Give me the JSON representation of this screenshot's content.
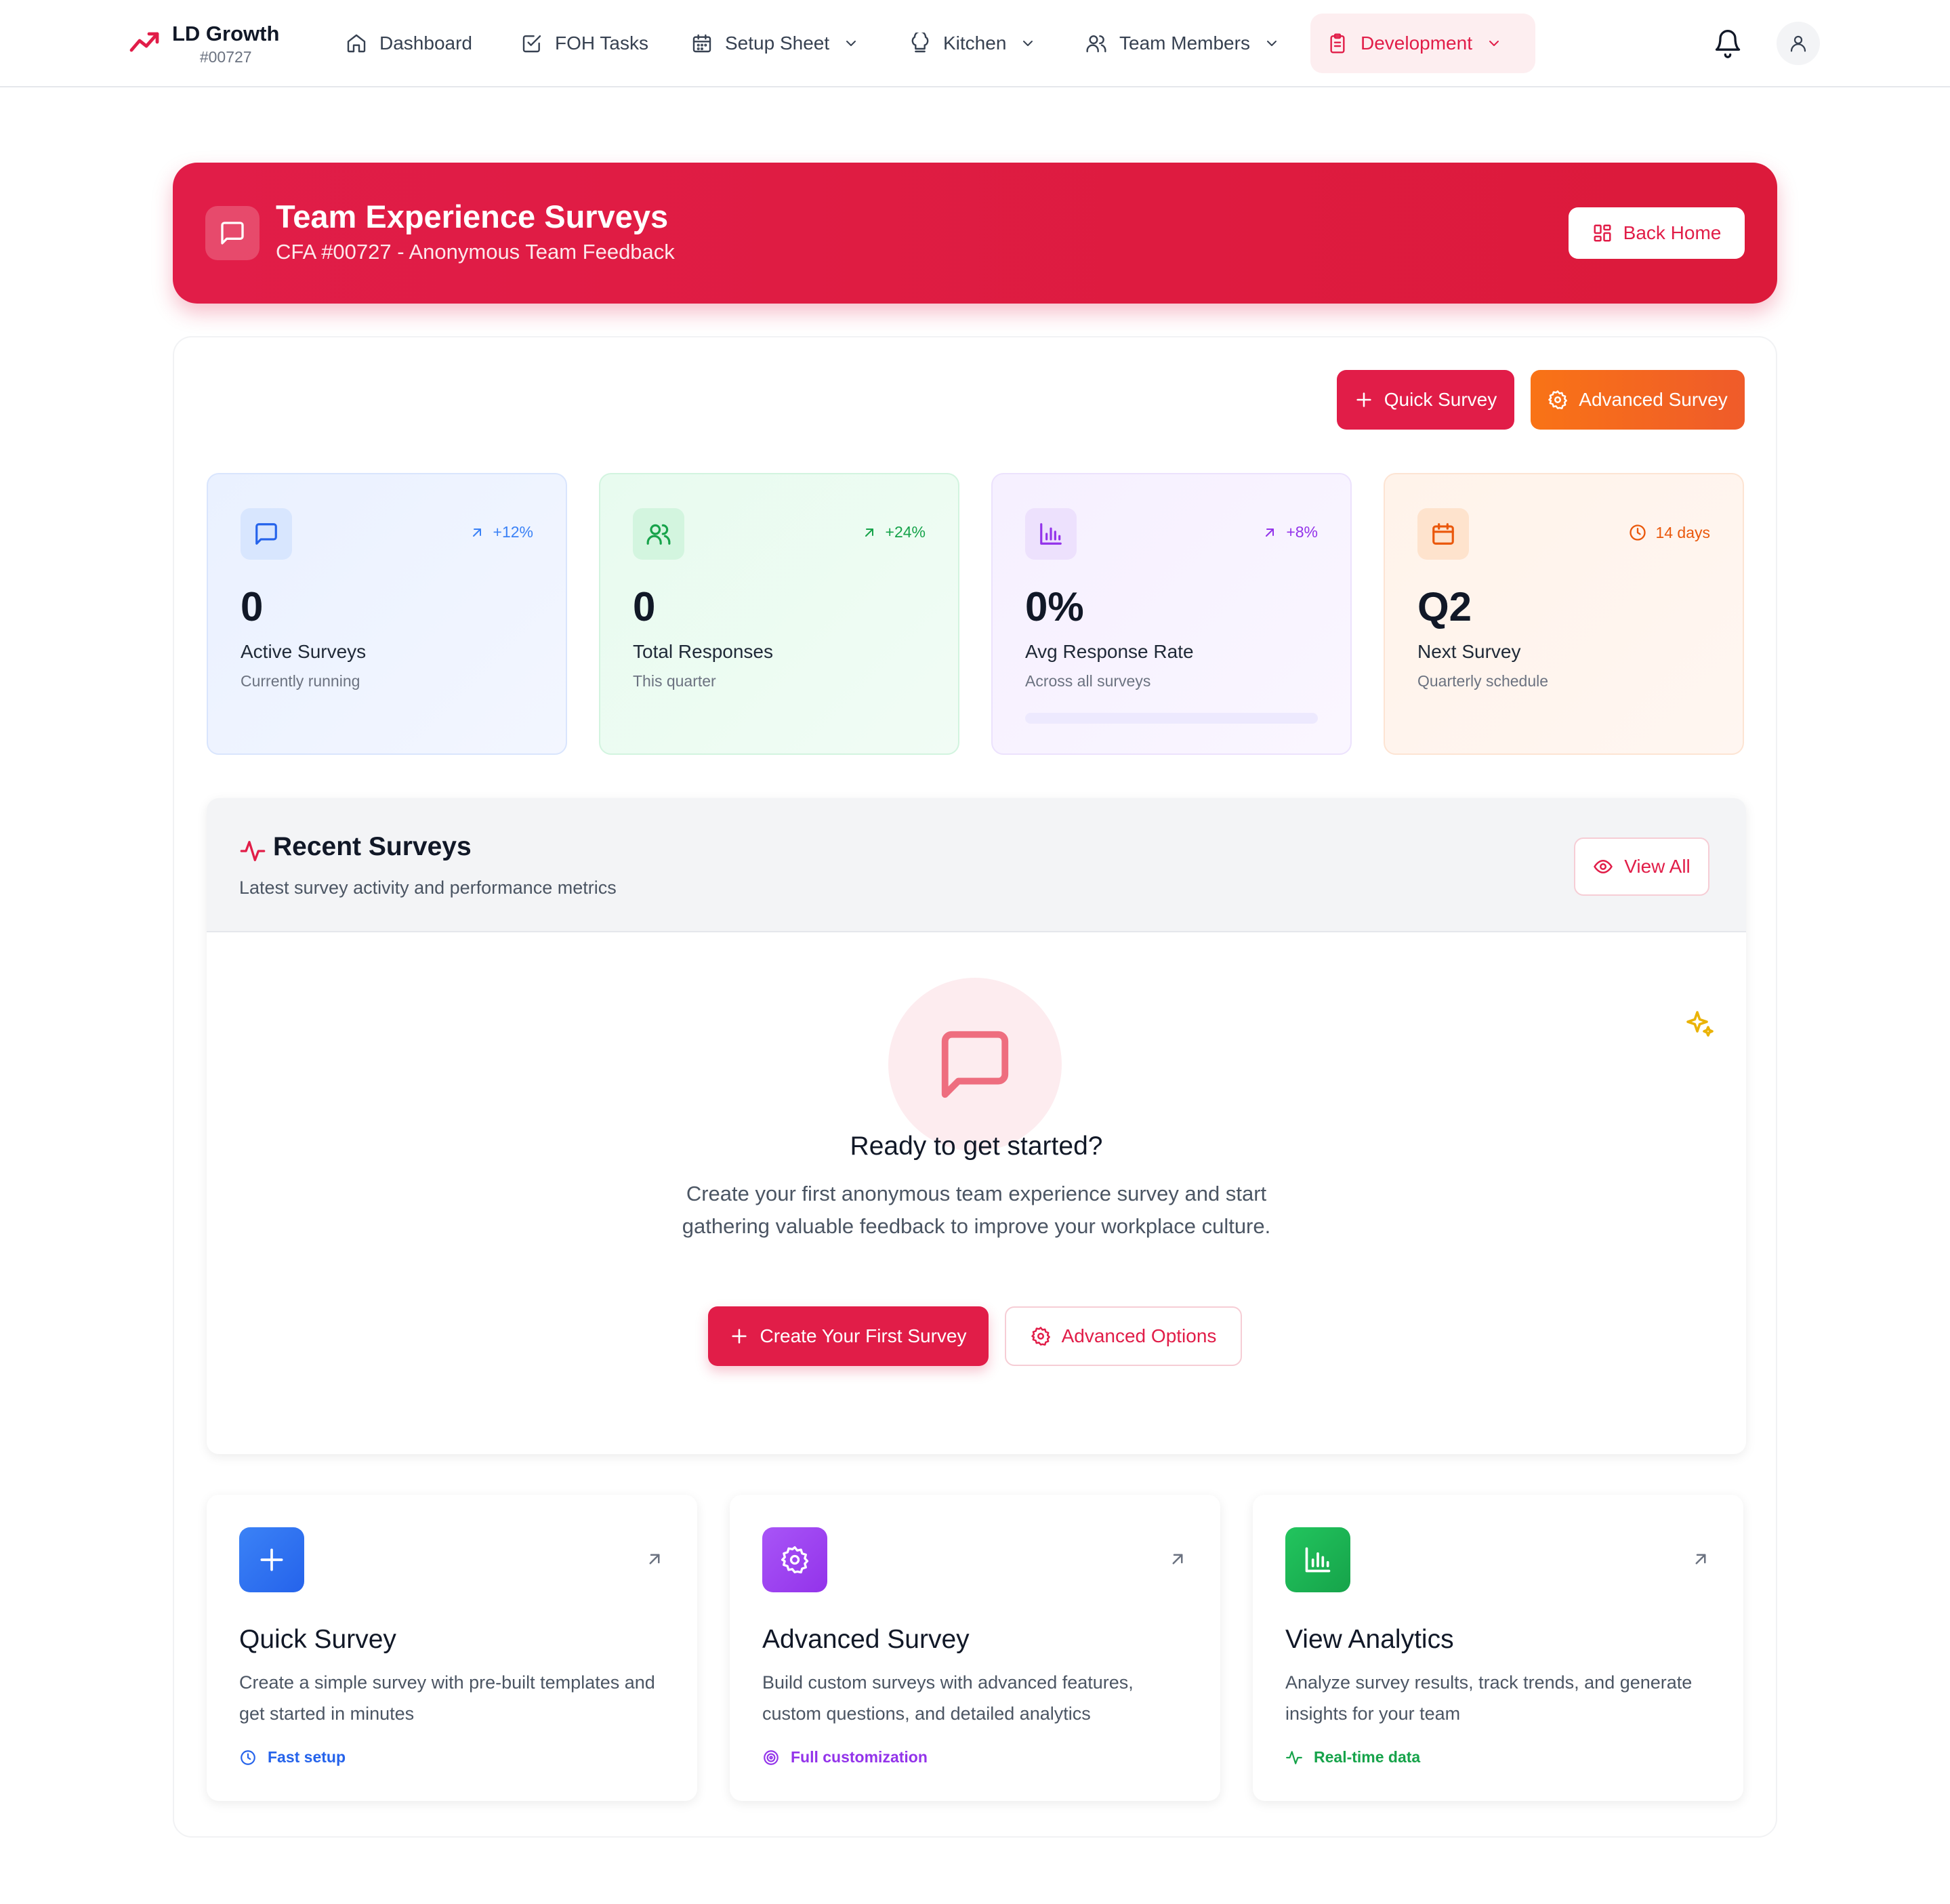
{
  "nav": {
    "brand_title": "LD Growth",
    "brand_sub": "#00727",
    "items": [
      {
        "label": "Dashboard",
        "icon": "home-icon"
      },
      {
        "label": "FOH Tasks",
        "icon": "checklist-icon"
      },
      {
        "label": "Setup Sheet",
        "icon": "calendar-icon",
        "dropdown": true
      },
      {
        "label": "Kitchen",
        "icon": "chef-hat-icon",
        "dropdown": true
      },
      {
        "label": "Team Members",
        "icon": "users-icon",
        "dropdown": true
      },
      {
        "label": "Development",
        "icon": "clipboard-icon",
        "dropdown": true,
        "active": true
      }
    ]
  },
  "hero": {
    "title": "Team Experience Surveys",
    "subtitle": "CFA #00727 - Anonymous Team Feedback",
    "back_home": "Back Home"
  },
  "actions": {
    "quick_survey": "Quick Survey",
    "advanced_survey": "Advanced Survey"
  },
  "stats": [
    {
      "value": "0",
      "label": "Active Surveys",
      "sub": "Currently running",
      "trend": "+12%"
    },
    {
      "value": "0",
      "label": "Total Responses",
      "sub": "This quarter",
      "trend": "+24%"
    },
    {
      "value": "0%",
      "label": "Avg Response Rate",
      "sub": "Across all surveys",
      "trend": "+8%",
      "progress": 0
    },
    {
      "value": "Q2",
      "label": "Next Survey",
      "sub": "Quarterly schedule",
      "trend": "14 days"
    }
  ],
  "recent": {
    "title": "Recent Surveys",
    "subtitle": "Latest survey activity and performance metrics",
    "view_all": "View All",
    "empty_title": "Ready to get started?",
    "empty_desc": "Create your first anonymous team experience survey and start gathering valuable feedback to improve your workplace culture.",
    "create_first": "Create Your First Survey",
    "advanced_options": "Advanced Options"
  },
  "features": [
    {
      "title": "Quick Survey",
      "desc": "Create a simple survey with pre-built templates and get started in minutes",
      "tag": "Fast setup"
    },
    {
      "title": "Advanced Survey",
      "desc": "Build custom surveys with advanced features, custom questions, and detailed analytics",
      "tag": "Full customization"
    },
    {
      "title": "View Analytics",
      "desc": "Analyze survey results, track trends, and generate insights for your team",
      "tag": "Real-time data"
    }
  ],
  "colors": {
    "brand_red": "#e11d48",
    "orange": "#f97316",
    "blue": "#2563eb",
    "green": "#16a34a",
    "purple": "#9333ea"
  }
}
